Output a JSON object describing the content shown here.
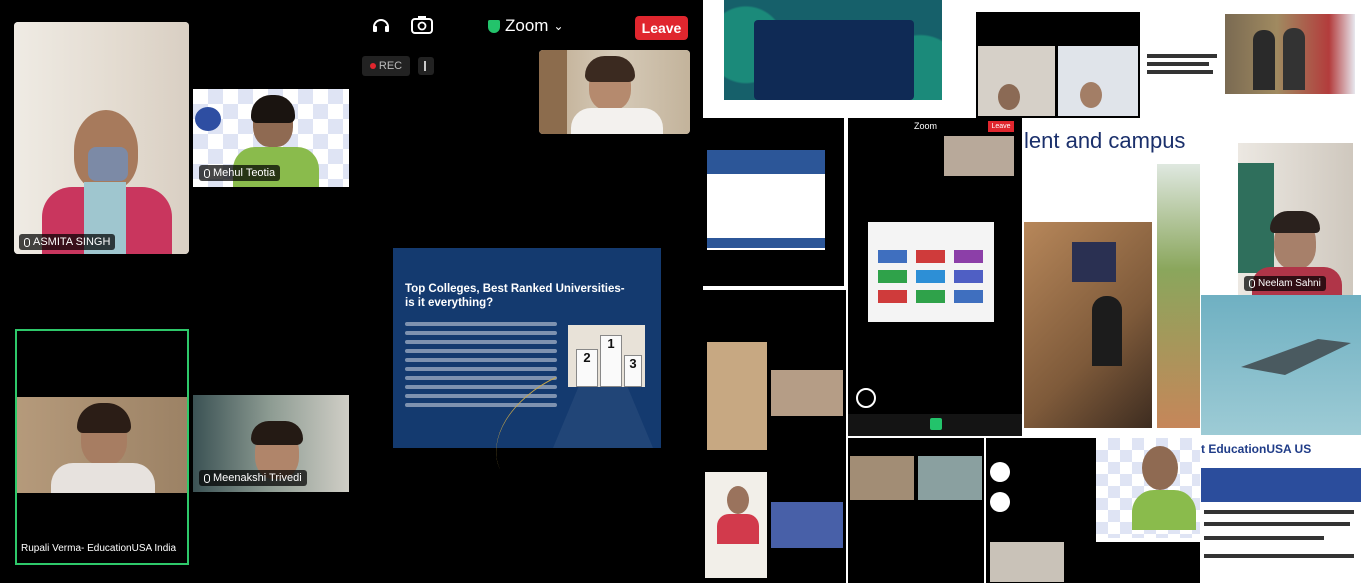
{
  "toolbar": {
    "app_title": "Zoom",
    "leave_label": "Leave",
    "rec_label": "REC"
  },
  "participants": {
    "asmita": "ASMITA SINGH",
    "mehul": "Mehul Teotia",
    "rupali": "Rupali Verma- EducationUSA India",
    "meenakshi": "Meenakshi Trivedi",
    "neelam": "Neelam Sahni"
  },
  "slide": {
    "title": "Top Colleges, Best Ranked Universities- is it everything?",
    "podium": [
      "2",
      "1",
      "3"
    ]
  },
  "collage": {
    "campus_heading": "lent and campus",
    "edusa_banner": "t EducationUSA US",
    "inner_zoom_leave": "Leave",
    "inner_zoom_title": "Zoom"
  },
  "colors": {
    "accent_green": "#2ec86a",
    "leave_red": "#e0262e",
    "slide_blue": "#143a6f"
  }
}
